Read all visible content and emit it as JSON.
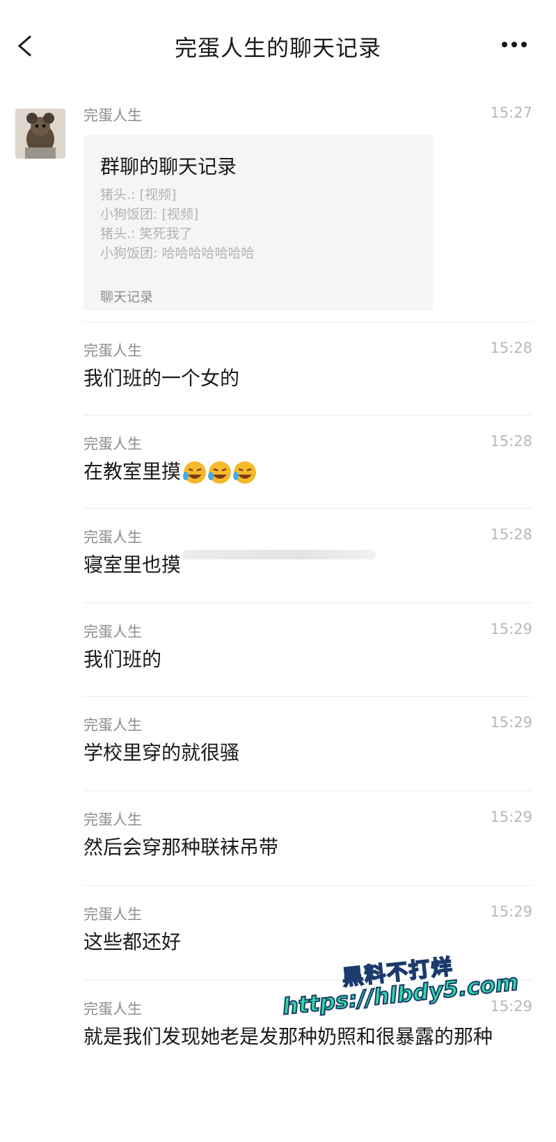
{
  "header": {
    "title": "完蛋人生的聊天记录"
  },
  "card": {
    "sender": "完蛋人生",
    "time": "15:27",
    "title": "群聊的聊天记录",
    "lines": [
      "猪头.: [视频]",
      "小狗饭团: [视频]",
      "猪头.: 笑死我了",
      "小狗饭团: 哈哈哈哈哈哈哈"
    ],
    "footer": "聊天记录"
  },
  "messages": [
    {
      "sender": "完蛋人生",
      "time": "15:28",
      "text": "我们班的一个女的"
    },
    {
      "sender": "完蛋人生",
      "time": "15:28",
      "text": "在教室里摸"
    },
    {
      "sender": "完蛋人生",
      "time": "15:28",
      "text": "寝室里也摸"
    },
    {
      "sender": "完蛋人生",
      "time": "15:29",
      "text": "我们班的"
    },
    {
      "sender": "完蛋人生",
      "time": "15:29",
      "text": "学校里穿的就很骚"
    },
    {
      "sender": "完蛋人生",
      "time": "15:29",
      "text": "然后会穿那种联袜吊带"
    },
    {
      "sender": "完蛋人生",
      "time": "15:29",
      "text": "这些都还好"
    },
    {
      "sender": "完蛋人生",
      "time": "15:29",
      "text": "就是我们发现她老是发那种奶照和很暴露的那种"
    }
  ],
  "emoji": "laughing-crying-emoji",
  "watermark": {
    "line1": "黑料不打烊",
    "line2": "https://hlbdy5.com"
  },
  "colors": {
    "card_bg": "#f5f5f5",
    "meta_text": "#8c8c8c",
    "time_text": "#b8b8b8",
    "watermark_fill": "#2fd9a4"
  }
}
